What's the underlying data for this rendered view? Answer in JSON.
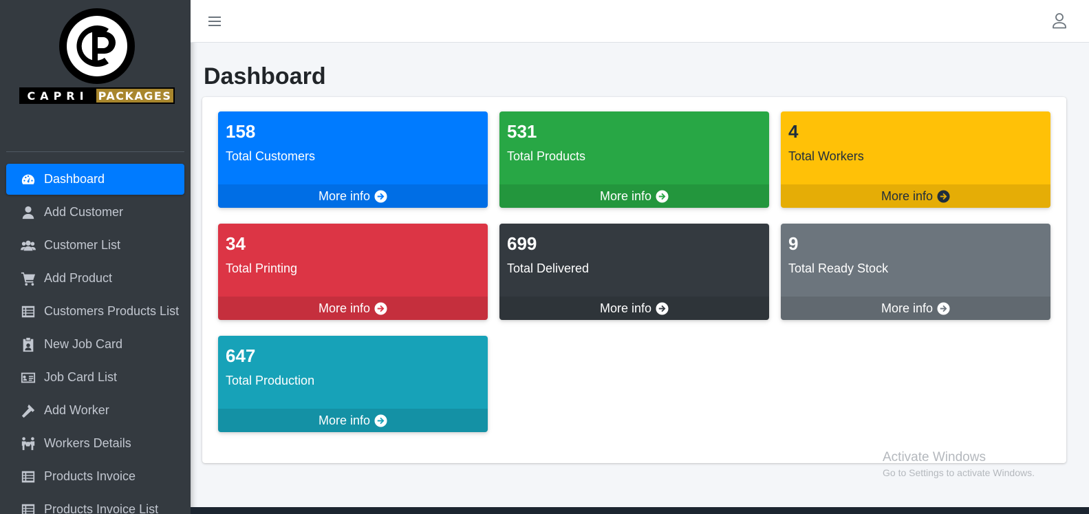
{
  "brand": {
    "word1": "CAPRI",
    "word2": "PACKAGES"
  },
  "sidebar": {
    "items": [
      {
        "label": "Dashboard",
        "icon": "tachometer-icon",
        "active": true
      },
      {
        "label": "Add Customer",
        "icon": "user-icon"
      },
      {
        "label": "Customer List",
        "icon": "users-icon"
      },
      {
        "label": "Add Product",
        "icon": "cart-icon"
      },
      {
        "label": "Customers Products List",
        "icon": "list-icon"
      },
      {
        "label": "New Job Card",
        "icon": "id-badge-icon"
      },
      {
        "label": "Job Card List",
        "icon": "id-card-icon"
      },
      {
        "label": "Add Worker",
        "icon": "hammer-icon"
      },
      {
        "label": "Workers Details",
        "icon": "people-carry-icon"
      },
      {
        "label": "Products Invoice",
        "icon": "list-icon"
      },
      {
        "label": "Products Invoice List",
        "icon": "list-icon"
      }
    ]
  },
  "header": {
    "menu_icon": "bars-icon",
    "user_icon": "user-outline-icon"
  },
  "page": {
    "title": "Dashboard"
  },
  "stats": [
    {
      "value": "158",
      "label": "Total Customers",
      "more": "More info",
      "color": "#007bff"
    },
    {
      "value": "531",
      "label": "Total Products",
      "more": "More info",
      "color": "#28a745"
    },
    {
      "value": "4",
      "label": "Total Workers",
      "more": "More info",
      "color": "#ffc107"
    },
    {
      "value": "34",
      "label": "Total Printing",
      "more": "More info",
      "color": "#dc3545"
    },
    {
      "value": "699",
      "label": "Total Delivered",
      "more": "More info",
      "color": "#343a40"
    },
    {
      "value": "9",
      "label": "Total Ready Stock",
      "more": "More info",
      "color": "#6c757d"
    },
    {
      "value": "647",
      "label": "Total Production",
      "more": "More info",
      "color": "#17a2b8"
    }
  ],
  "watermark": {
    "line1": "Activate Windows",
    "line2": "Go to Settings to activate Windows."
  }
}
